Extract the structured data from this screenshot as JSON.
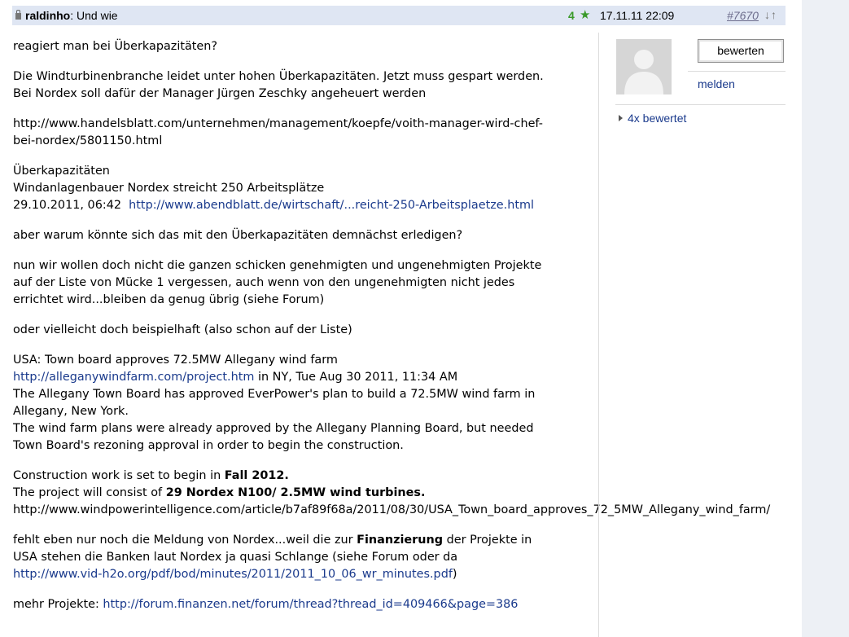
{
  "post": {
    "username": "raldinho",
    "title_sep": ": ",
    "title": "Und wie",
    "rating": "4",
    "date": "17.11.11 22:09",
    "number": "#7670",
    "nav_arrows": "↓↑"
  },
  "body": {
    "p1": "reagiert man bei Überkapazitäten?",
    "p2_l1": "Die Windturbinenbranche leidet unter hohen Überkapazitäten. Jetzt muss  gespart werden.",
    "p2_l2": "Bei Nordex soll dafür der Manager Jürgen Zeschky  angeheuert werden",
    "p3_l1": "http://www.handelsblatt.com/unternehmen/management/koepfe/voith-manager-wird-chef-",
    "p3_l2": "bei-nordex/5801150.html",
    "p4_l1": "Überkapazitäten",
    "p4_l2": "Windanlagenbauer Nordex streicht 250 Arbeitsplätze",
    "p4_l3_date": "29.10.2011, 06:42  ",
    "p4_l3_link": "http://www.abendblatt.de/wirtschaft/...reicht-250-Arbeitsplaetze.html",
    "p5": "aber warum könnte sich das mit den Überkapazitäten demnächst erledigen?",
    "p6_l1": "nun wir wollen doch nicht die ganzen schicken genehmigten und ungenehmigten Projekte",
    "p6_l2": "auf der Liste von Mücke 1 vergessen, auch wenn von den ungenehmigten nicht jedes",
    "p6_l3": "errichtet wird...bleiben da genug übrig (siehe Forum)",
    "p7": "oder vielleicht doch beispielhaft (also schon auf der Liste)",
    "p8_l1": "USA: Town board approves 72.5MW Allegany wind farm",
    "p8_l2_link": "http://alleganywindfarm.com/project.htm",
    "p8_l2_text": " in NY, Tue Aug 30 2011, 11:34 AM",
    "p8_l3": "The Allegany Town Board has approved EverPower's plan to build a 72.5MW wind farm in",
    "p8_l4": "Allegany, New York.",
    "p8_l5": "The wind farm plans were already approved by the Allegany Planning Board, but needed",
    "p8_l6": "Town Board's rezoning approval in order to begin the construction.",
    "p9_l1_text": "Construction work is set to begin in ",
    "p9_l1_bold": "Fall 2012.",
    "p9_l2_text": "The project will consist of ",
    "p9_l2_bold": "29 Nordex N100/ 2.5MW wind turbines.",
    "p9_l3": "http://www.windpowerintelligence.com/article/b7af89f68a/2011/08/30/USA_Town_board_approves_72_5MW_Allegany_wind_farm/",
    "p10_l1_a": "fehlt eben nur noch die Meldung von Nordex...weil die zur ",
    "p10_l1_bold": "Finanzierung",
    "p10_l1_b": " der Projekte in",
    "p10_l2": "USA  stehen die Banken laut Nordex ja quasi Schlange (siehe Forum oder da",
    "p10_l3_link": "http://www.vid-h2o.org/pdf/bod/minutes/2011/2011_10_06_wr_minutes.pdf",
    "p10_l3_close": ")",
    "p11_text": "mehr Projekte: ",
    "p11_link": "http://forum.finanzen.net/forum/thread?thread_id=409466&page=386"
  },
  "sidebar": {
    "rate_button": "bewerten",
    "report_link": "melden",
    "rated_count": "4x bewertet"
  },
  "colors": {
    "header_bg": "#dfe6f3",
    "link": "#1a3a8c",
    "rating_green": "#3a9a2a"
  },
  "icons": {
    "lock": "lock-icon",
    "star": "star-icon",
    "avatar": "default-avatar-silhouette",
    "expand": "triangle-right-icon"
  }
}
